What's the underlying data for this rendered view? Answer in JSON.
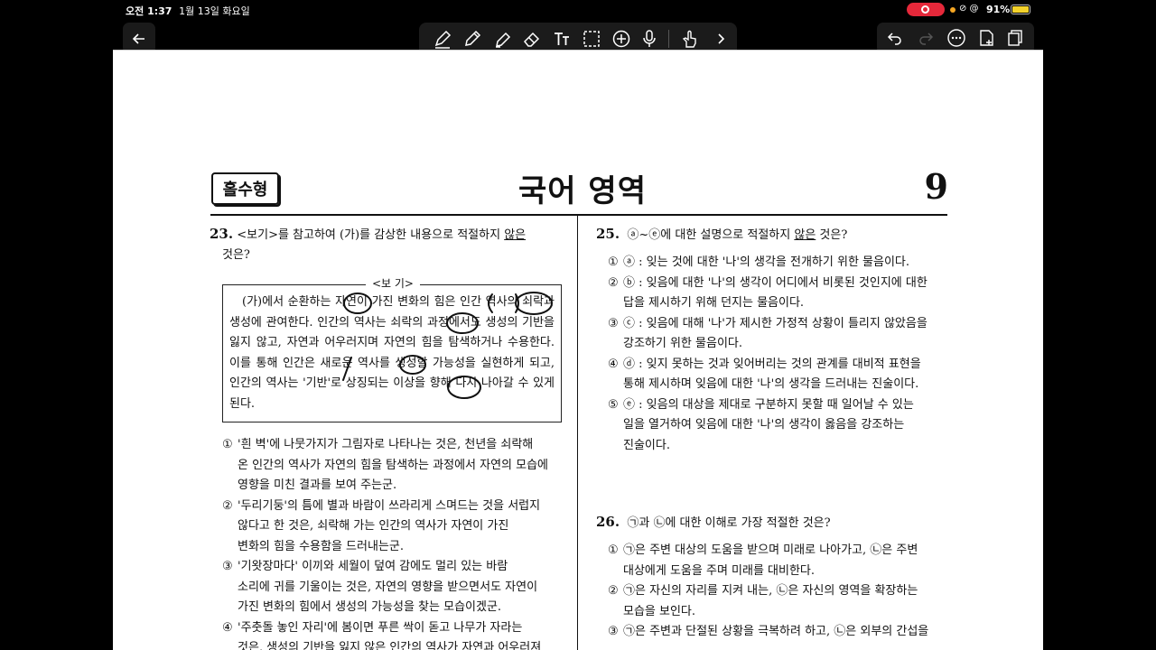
{
  "status": {
    "time": "오전 1:37",
    "date": "1월 13일 화요일",
    "battery": "91%",
    "icons": [
      "recording-icon",
      "link-icon",
      "at-icon"
    ]
  },
  "toolbar": {
    "tools": [
      "pen-icon",
      "pencil-icon",
      "highlighter-icon",
      "eraser-icon",
      "text-icon",
      "lasso-icon",
      "add-icon",
      "mic-icon",
      "touch-icon",
      "chevron-right-icon"
    ],
    "colors": [
      "#1e6cf0",
      "#e02020",
      "#3cba3c",
      "#ffffff",
      "#fbf7e6",
      "#e619c8"
    ],
    "add_color": "+",
    "right_tools": [
      "undo-icon",
      "redo-icon",
      "more-icon",
      "add-page-icon",
      "pages-icon"
    ]
  },
  "page": {
    "badge": "홀수형",
    "title": "국어 영역",
    "number": "9",
    "q23": {
      "num": "23.",
      "text_a": "<보기>를 참고하여 (가)를 감상한 내용으로 적절하지 ",
      "text_u": "않은",
      "text_b": "것은?",
      "bogi_label": "<보  기>",
      "bogi_text": "(가)에서 순환하는 자연이 가진 변화의 힘은 인간 역사의 쇠락과 생성에 관여한다. 인간의 역사는 쇠락의 과정에서도 생성의 기반을 잃지 않고, 자연과 어우러지며 자연의 힘을 탐색하거나 수용한다. 이를 통해 인간은 새로운 역사를 생성할 가능성을 실현하게 되고, 인간의 역사는 '기반'로 상징되는 이상을 향해 다시 나아갈 수 있게 된다.",
      "options": [
        [
          "①",
          "'흰 벽'에 나뭇가지가 그림자로 나타나는 것은, 천년을 쇠락해",
          "온 인간의 역사가 자연의 힘을 탐색하는 과정에서 자연의 모습에",
          "영향을 미친 결과를 보여 주는군."
        ],
        [
          "②",
          "'두리기둥'의 틈에 별과 바람이 쓰라리게 스며드는 것을 서럽지",
          "않다고 한 것은, 쇠락해 가는 인간의 역사가 자연이 가진",
          "변화의 힘을 수용함을 드러내는군."
        ],
        [
          "③",
          "'기왓장마다' 이끼와 세월이 덮여 감에도 멀리 있는 바람",
          "소리에 귀를 기울이는 것은, 자연의 영향을 받으면서도 자연이",
          "가진 변화의 힘에서 생성의 가능성을 찾는 모습이겠군."
        ],
        [
          "④",
          "'주춧돌 놓인 자리'에 봄이면 푸른 싹이 돋고 나무가 자라는",
          "것은, 생성의 기반을 잃지 않은 인간의 역사가 자연과 어우러져",
          ""
        ]
      ]
    },
    "q25": {
      "num": "25.",
      "text_a": "ⓐ~ⓔ에 대한 설명으로 적절하지 ",
      "text_u": "않은",
      "text_b": " 것은?",
      "options": [
        [
          "①",
          "ⓐ : 잊는 것에 대한 '나'의 생각을 전개하기 위한 물음이다.",
          ""
        ],
        [
          "②",
          "ⓑ : 잊음에 대한 '나'의 생각이 어디에서 비롯된 것인지에 대한",
          "답을 제시하기 위해 던지는 물음이다."
        ],
        [
          "③",
          "ⓒ : 잊음에 대해 '나'가 제시한 가정적 상황이 틀리지 않았음을",
          "강조하기 위한 물음이다."
        ],
        [
          "④",
          "ⓓ : 잊지 못하는 것과 잊어버리는 것의 관계를 대비적 표현을",
          "통해 제시하며 잊음에 대한 '나'의 생각을 드러내는 진술이다."
        ],
        [
          "⑤",
          "ⓔ : 잊음의 대상을 제대로 구분하지 못할 때 일어날 수 있는",
          "일을 열거하여 잊음에 대한 '나'의 생각이 옳음을 강조하는",
          "진술이다."
        ]
      ]
    },
    "q26": {
      "num": "26.",
      "text": "㉠과 ㉡에 대한 이해로 가장 적절한 것은?",
      "options": [
        [
          "①",
          "㉠은 주변 대상의 도움을 받으며 미래로 나아가고, ㉡은 주변",
          "대상에게 도움을 주며 미래를 대비한다."
        ],
        [
          "②",
          "㉠은 자신의 자리를 지켜 내는, ㉡은 자신의 영역을 확장하는",
          "모습을 보인다."
        ],
        [
          "③",
          "㉠은 주변과 단절된 상황을 극복하려 하고, ㉡은 외부의 간섭을",
          ""
        ]
      ]
    }
  }
}
